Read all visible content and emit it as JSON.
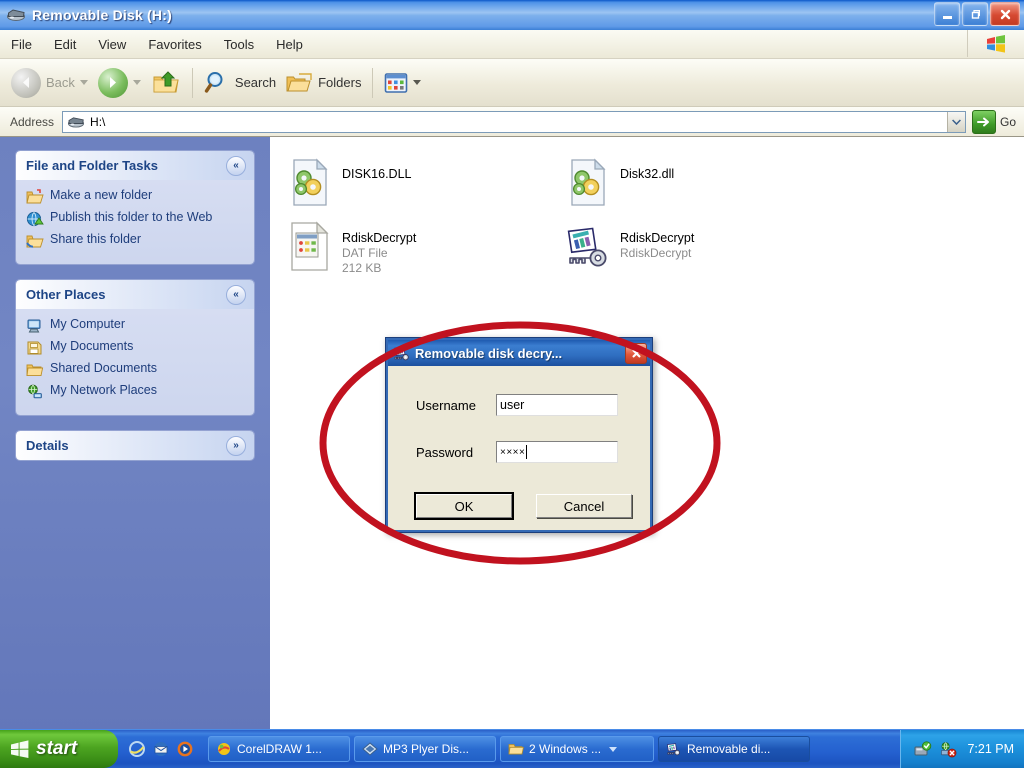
{
  "window": {
    "title": "Removable Disk (H:)",
    "icon": "removable-disk-icon",
    "controls": {
      "minimize": "_",
      "maximize": "❐",
      "close": "✕"
    }
  },
  "menubar": {
    "items": [
      {
        "label": "File"
      },
      {
        "label": "Edit"
      },
      {
        "label": "View"
      },
      {
        "label": "Favorites"
      },
      {
        "label": "Tools"
      },
      {
        "label": "Help"
      }
    ],
    "logo": "windows-flag-logo"
  },
  "toolbar": {
    "back_label": "Back",
    "search_label": "Search",
    "folders_label": "Folders",
    "icons": {
      "back": "back-arrow-icon",
      "forward": "forward-arrow-icon",
      "up": "up-folder-icon",
      "search": "magnifier-icon",
      "folders": "folders-icon",
      "views": "views-icon"
    }
  },
  "address": {
    "label": "Address",
    "value": "H:\\",
    "icon": "removable-disk-icon",
    "dropdown": "⌄",
    "go_label": "Go",
    "go_icon": "green-arrow-icon"
  },
  "sidebar": {
    "panels": [
      {
        "title": "File and Folder Tasks",
        "chevron": "«",
        "chevron_state": "expanded",
        "collapsed": false,
        "links": [
          {
            "label": "Make a new folder",
            "icon": "new-folder-icon"
          },
          {
            "label": "Publish this folder to the Web",
            "icon": "publish-web-icon"
          },
          {
            "label": "Share this folder",
            "icon": "share-folder-icon"
          }
        ]
      },
      {
        "title": "Other Places",
        "chevron": "«",
        "chevron_state": "expanded",
        "collapsed": false,
        "links": [
          {
            "label": "My Computer",
            "icon": "my-computer-icon"
          },
          {
            "label": "My Documents",
            "icon": "my-documents-icon"
          },
          {
            "label": "Shared Documents",
            "icon": "shared-documents-icon"
          },
          {
            "label": "My Network Places",
            "icon": "network-places-icon"
          }
        ]
      },
      {
        "title": "Details",
        "chevron": "»",
        "chevron_state": "collapsed",
        "collapsed": true,
        "links": []
      }
    ]
  },
  "files": [
    {
      "name": "DISK16.DLL",
      "type": "",
      "size": "",
      "icon": "dll-file-icon"
    },
    {
      "name": "Disk32.dll",
      "type": "",
      "size": "",
      "icon": "dll-file-icon"
    },
    {
      "name": "RdiskDecrypt",
      "type": "DAT File",
      "size": "212 KB",
      "icon": "dat-file-icon"
    },
    {
      "name": "RdiskDecrypt",
      "type": "RdiskDecrypt",
      "size": "",
      "icon": "rdiskdecrypt-app-icon"
    }
  ],
  "dialog": {
    "title": "Removable disk decry...",
    "icon": "rdiskdecrypt-app-icon",
    "close": "✕",
    "fields": [
      {
        "label": "Username",
        "value": "user",
        "type": "text"
      },
      {
        "label": "Password",
        "value": "××××",
        "type": "password"
      }
    ],
    "buttons": [
      {
        "label": "OK",
        "default": true
      },
      {
        "label": "Cancel",
        "default": false
      }
    ]
  },
  "annotation": {
    "shape": "ellipse",
    "color": "#c1121f",
    "stroke_width": 7
  },
  "taskbar": {
    "start_label": "start",
    "start_icon": "windows-flag-logo",
    "quick_launch": [
      {
        "icon": "internet-explorer-icon"
      },
      {
        "icon": "outlook-express-icon"
      },
      {
        "icon": "media-player-icon"
      }
    ],
    "tasks": [
      {
        "label": "CorelDRAW 1...",
        "icon": "coreldraw-icon",
        "active": false,
        "grouped": false
      },
      {
        "label": "MP3 Plyer Dis...",
        "icon": "mp3-player-icon",
        "active": false,
        "grouped": false
      },
      {
        "label": "2 Windows ...",
        "icon": "folder-icon",
        "active": false,
        "grouped": true
      },
      {
        "label": "Removable di...",
        "icon": "rdiskdecrypt-app-icon",
        "active": true,
        "grouped": false
      }
    ],
    "tray": {
      "icons": [
        {
          "icon": "safely-remove-hardware-icon"
        },
        {
          "icon": "network-error-icon"
        }
      ],
      "time": "7:21 PM"
    }
  }
}
